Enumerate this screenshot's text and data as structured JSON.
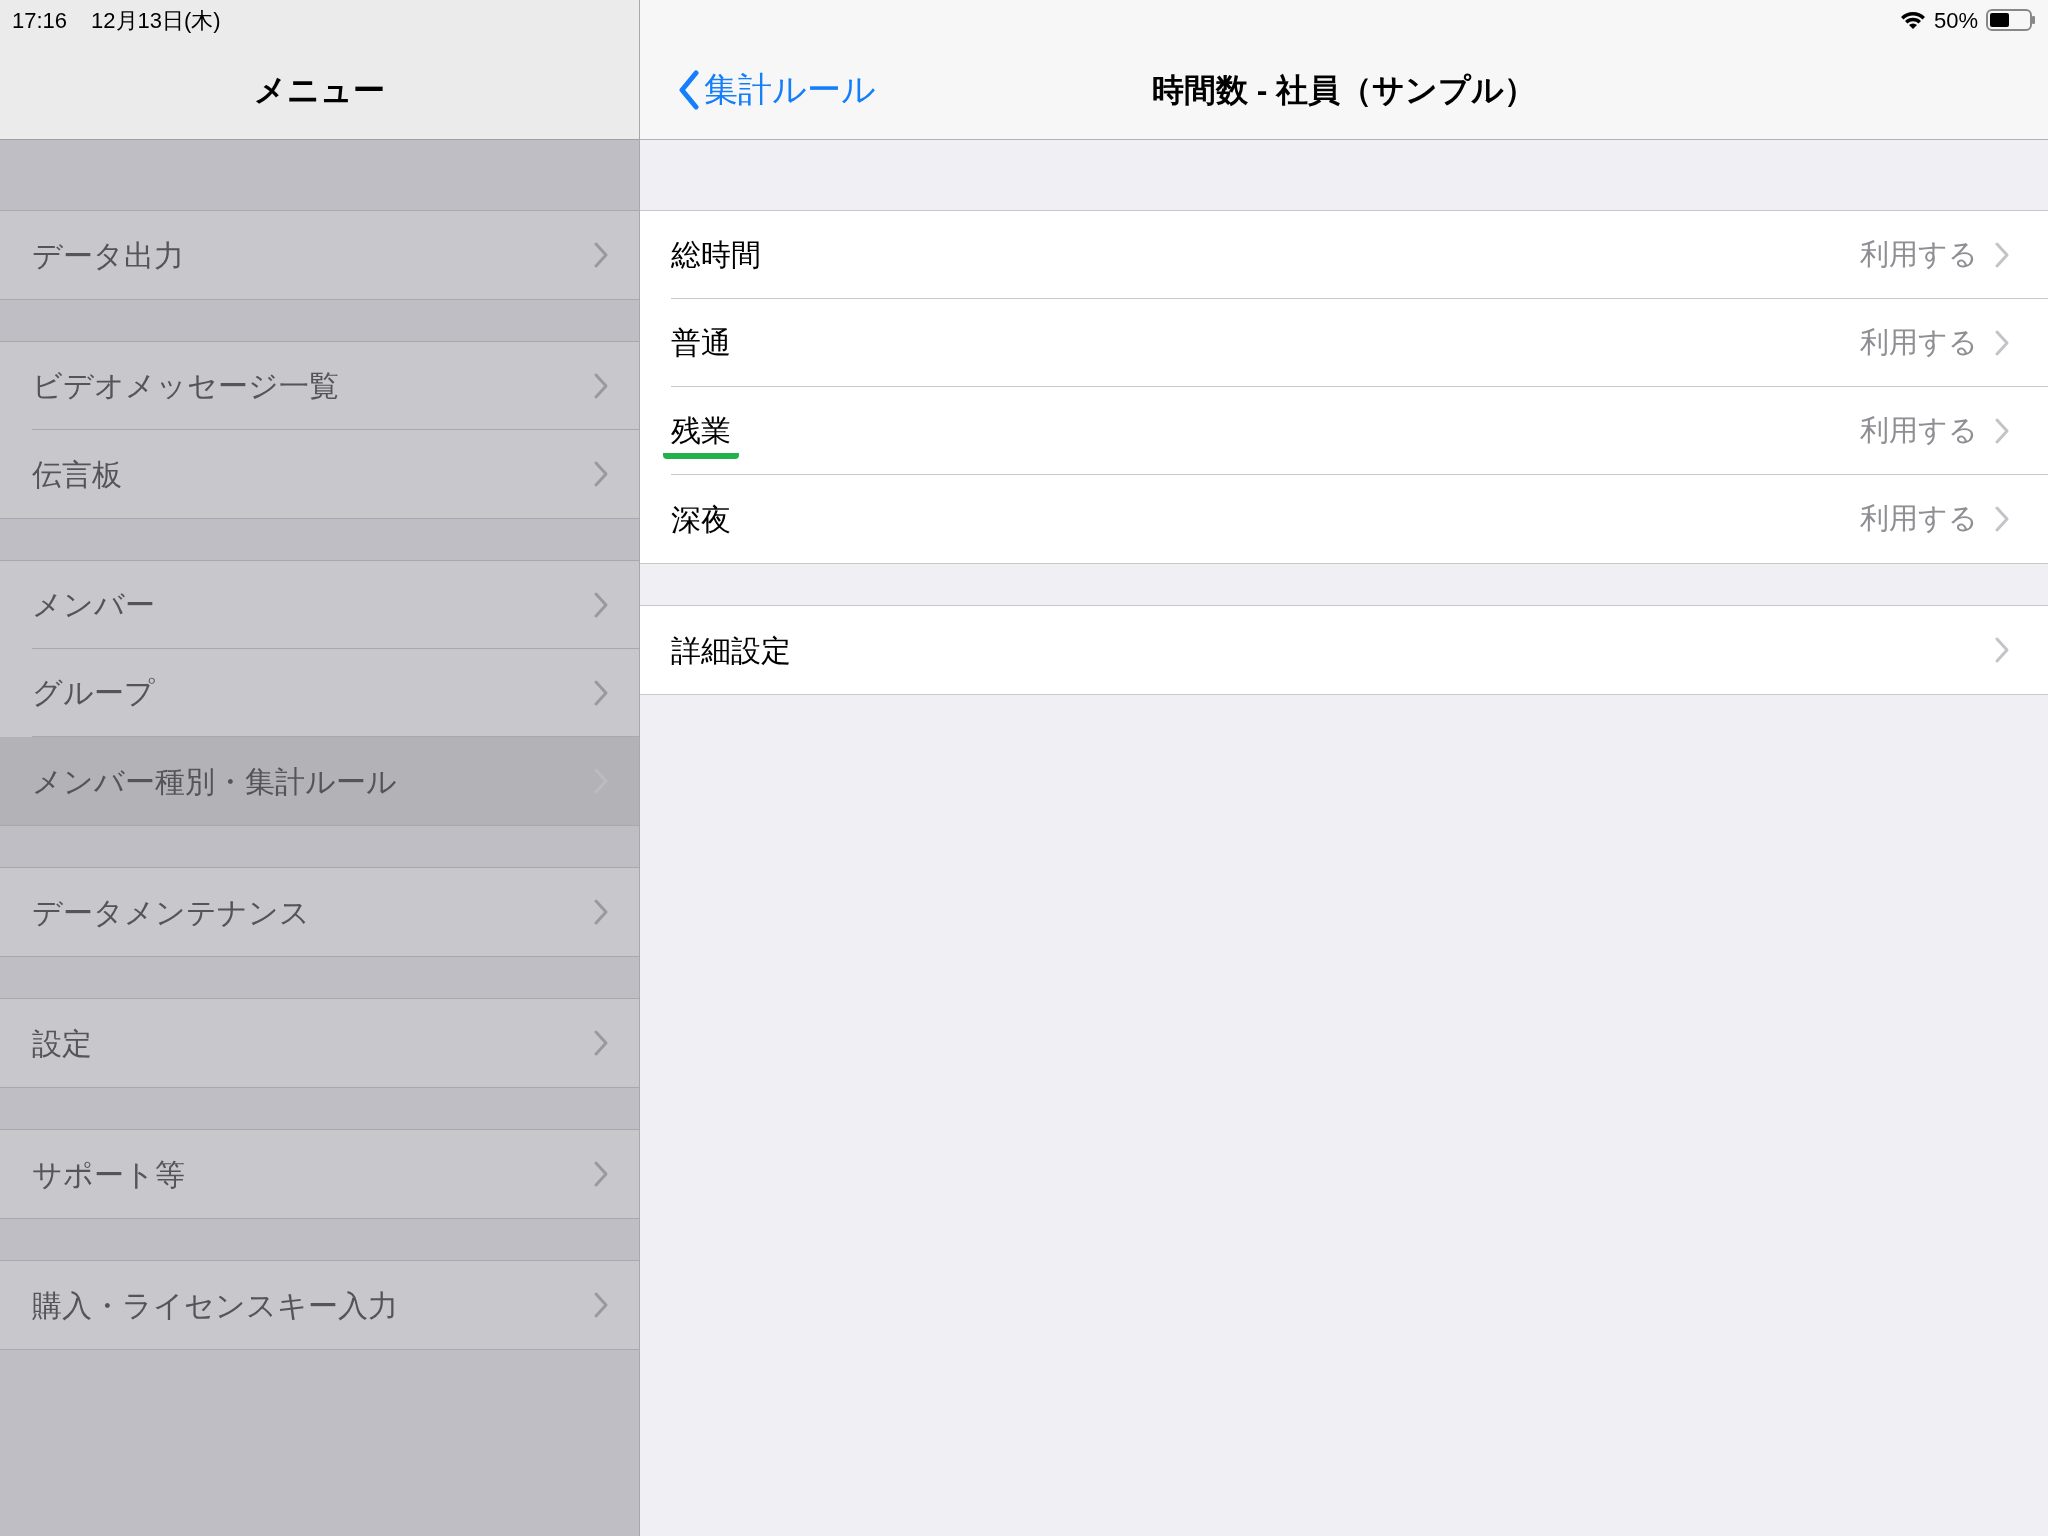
{
  "status_bar": {
    "time": "17:16",
    "date": "12月13日(木)",
    "battery": "50%"
  },
  "sidebar": {
    "title": "メニュー",
    "sections": [
      {
        "items": [
          {
            "label": "データ出力",
            "selected": false
          }
        ]
      },
      {
        "items": [
          {
            "label": "ビデオメッセージ一覧",
            "selected": false
          },
          {
            "label": "伝言板",
            "selected": false
          }
        ]
      },
      {
        "items": [
          {
            "label": "メンバー",
            "selected": false
          },
          {
            "label": "グループ",
            "selected": false
          },
          {
            "label": "メンバー種別・集計ルール",
            "selected": true
          }
        ]
      },
      {
        "items": [
          {
            "label": "データメンテナンス",
            "selected": false
          }
        ]
      },
      {
        "items": [
          {
            "label": "設定",
            "selected": false
          }
        ]
      },
      {
        "items": [
          {
            "label": "サポート等",
            "selected": false
          }
        ]
      },
      {
        "items": [
          {
            "label": "購入・ライセンスキー入力",
            "selected": false
          }
        ]
      }
    ]
  },
  "detail": {
    "back_label": "集計ルール",
    "title": "時間数 - 社員（サンプル）",
    "sections": [
      {
        "rows": [
          {
            "label": "総時間",
            "value": "利用する",
            "highlighted": false
          },
          {
            "label": "普通",
            "value": "利用する",
            "highlighted": false
          },
          {
            "label": "残業",
            "value": "利用する",
            "highlighted": true
          },
          {
            "label": "深夜",
            "value": "利用する",
            "highlighted": false
          }
        ]
      },
      {
        "rows": [
          {
            "label": "詳細設定",
            "highlighted": false
          }
        ]
      }
    ]
  }
}
